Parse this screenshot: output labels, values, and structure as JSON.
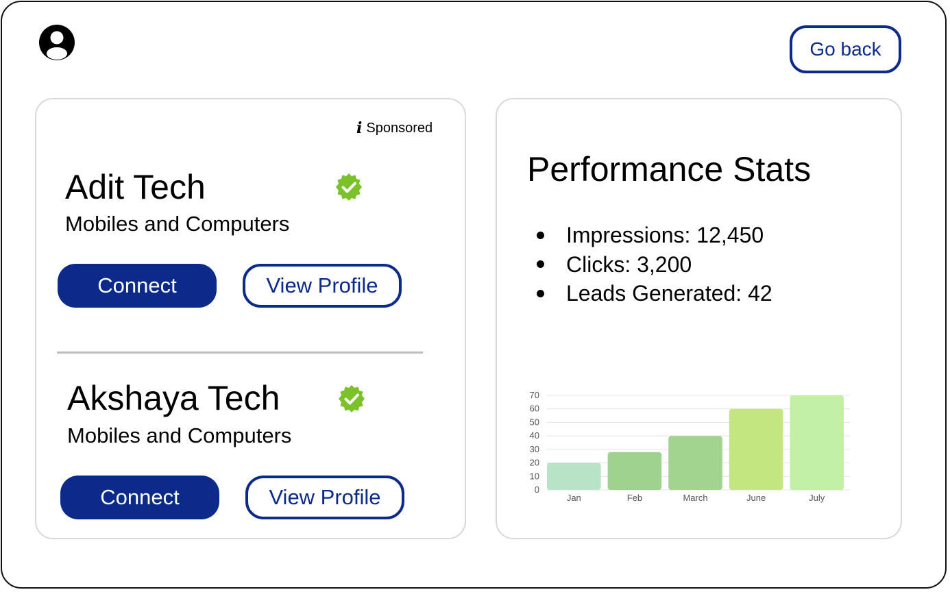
{
  "header": {
    "avatar_icon": "user-circle-icon",
    "go_back_label": "Go back"
  },
  "sponsored": {
    "icon": "info-icon",
    "icon_glyph": "i",
    "label": "Sponsored"
  },
  "companies": [
    {
      "name": "Adit Tech",
      "category": "Mobiles and Computers",
      "verified_icon": "verified-badge-icon",
      "connect_label": "Connect",
      "view_profile_label": "View Profile"
    },
    {
      "name": "Akshaya Tech",
      "category": "Mobiles and Computers",
      "verified_icon": "verified-badge-icon",
      "connect_label": "Connect",
      "view_profile_label": "View Profile"
    }
  ],
  "stats": {
    "title": "Performance Stats",
    "items": [
      "Impressions: 12,450",
      "Clicks: 3,200",
      "Leads Generated: 42"
    ]
  },
  "colors": {
    "primary": "#0b2a8a",
    "verified": "#7ac12a",
    "card_border": "#d9d9d9"
  },
  "chart_data": {
    "type": "bar",
    "categories": [
      "Jan",
      "Feb",
      "March",
      "June",
      "July"
    ],
    "values": [
      20,
      28,
      40,
      60,
      70
    ],
    "bar_colors": [
      "#b8e3c6",
      "#9fd18f",
      "#a3d48f",
      "#c4e680",
      "#c1f0a6"
    ],
    "ylim": [
      0,
      70
    ],
    "yticks": [
      0,
      10,
      20,
      30,
      40,
      50,
      60,
      70
    ],
    "grid": true,
    "title": "",
    "xlabel": "",
    "ylabel": ""
  }
}
